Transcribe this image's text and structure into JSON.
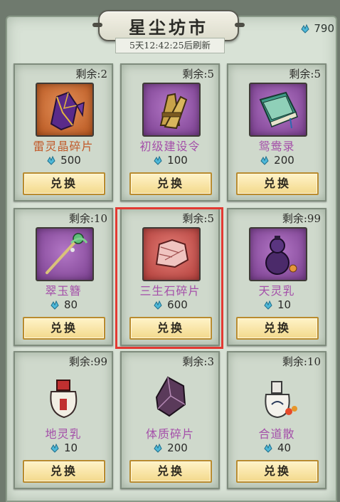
{
  "title": "星尘坊市",
  "currency": {
    "icon": "blue-crystal-icon",
    "amount": "790"
  },
  "refresh_text": "5天12:42:25后刷新",
  "items": [
    {
      "remain": "剩余:2",
      "name": "雷灵晶碎片",
      "price": "500",
      "button": "兑换",
      "icon": "purple-crystal-icon",
      "bg": "orange",
      "name_color": "orange"
    },
    {
      "remain": "剩余:5",
      "name": "初级建设令",
      "price": "100",
      "button": "兑换",
      "icon": "scroll-bundle-icon",
      "bg": "purple",
      "name_color": "purple"
    },
    {
      "remain": "剩余:5",
      "name": "鸳鸯录",
      "price": "200",
      "button": "兑换",
      "icon": "book-icon",
      "bg": "purple",
      "name_color": "purple"
    },
    {
      "remain": "剩余:10",
      "name": "翠玉簪",
      "price": "80",
      "button": "兑换",
      "icon": "hairpin-icon",
      "bg": "purple",
      "name_color": "purple"
    },
    {
      "remain": "剩余:5",
      "name": "三生石碎片",
      "price": "600",
      "button": "兑换",
      "icon": "stone-fragment-icon",
      "bg": "red",
      "name_color": "purple",
      "highlighted": true
    },
    {
      "remain": "剩余:99",
      "name": "天灵乳",
      "price": "10",
      "button": "兑换",
      "icon": "gourd-icon",
      "bg": "purple",
      "name_color": "purple"
    },
    {
      "remain": "剩余:99",
      "name": "地灵乳",
      "price": "10",
      "button": "兑换",
      "icon": "jar-icon",
      "bg": "none",
      "name_color": "purple"
    },
    {
      "remain": "剩余:3",
      "name": "体质碎片",
      "price": "200",
      "button": "兑换",
      "icon": "dark-crystal-icon",
      "bg": "none",
      "name_color": "purple"
    },
    {
      "remain": "剩余:10",
      "name": "合道散",
      "price": "40",
      "button": "兑换",
      "icon": "bottle-pills-icon",
      "bg": "none",
      "name_color": "purple"
    }
  ],
  "colors": {
    "highlight": "#e23a33",
    "name_purple": "#a44fa9",
    "name_orange": "#c15a2a",
    "button_fill": "#f3d98c"
  }
}
